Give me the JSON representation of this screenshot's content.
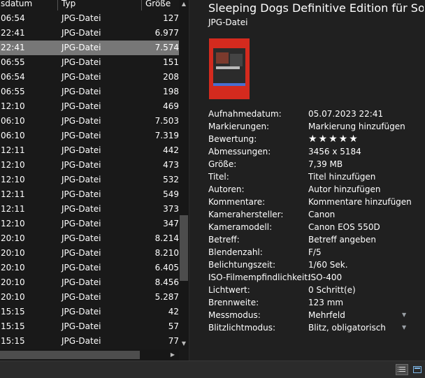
{
  "file_list": {
    "columns": {
      "date": "sdatum",
      "type": "Typ",
      "size": "Größe"
    },
    "rows": [
      {
        "date": "06:54",
        "type": "JPG-Datei",
        "size": "127"
      },
      {
        "date": "22:41",
        "type": "JPG-Datei",
        "size": "6.977"
      },
      {
        "date": "22:41",
        "type": "JPG-Datei",
        "size": "7.574",
        "selected": true
      },
      {
        "date": "06:55",
        "type": "JPG-Datei",
        "size": "151"
      },
      {
        "date": "06:54",
        "type": "JPG-Datei",
        "size": "208"
      },
      {
        "date": "06:55",
        "type": "JPG-Datei",
        "size": "198"
      },
      {
        "date": "12:10",
        "type": "JPG-Datei",
        "size": "469"
      },
      {
        "date": "06:10",
        "type": "JPG-Datei",
        "size": "7.503"
      },
      {
        "date": "06:10",
        "type": "JPG-Datei",
        "size": "7.319"
      },
      {
        "date": "12:11",
        "type": "JPG-Datei",
        "size": "442"
      },
      {
        "date": "12:10",
        "type": "JPG-Datei",
        "size": "473"
      },
      {
        "date": "12:10",
        "type": "JPG-Datei",
        "size": "532"
      },
      {
        "date": "12:11",
        "type": "JPG-Datei",
        "size": "549"
      },
      {
        "date": "12:11",
        "type": "JPG-Datei",
        "size": "373"
      },
      {
        "date": "12:10",
        "type": "JPG-Datei",
        "size": "347"
      },
      {
        "date": "20:10",
        "type": "JPG-Datei",
        "size": "8.214"
      },
      {
        "date": "20:10",
        "type": "JPG-Datei",
        "size": "8.210"
      },
      {
        "date": "20:10",
        "type": "JPG-Datei",
        "size": "6.405"
      },
      {
        "date": "20:10",
        "type": "JPG-Datei",
        "size": "8.456"
      },
      {
        "date": "20:10",
        "type": "JPG-Datei",
        "size": "5.287"
      },
      {
        "date": "15:15",
        "type": "JPG-Datei",
        "size": "42"
      },
      {
        "date": "15:15",
        "type": "JPG-Datei",
        "size": "57"
      },
      {
        "date": "15:15",
        "type": "JPG-Datei",
        "size": "77"
      }
    ]
  },
  "details": {
    "title": "Sleeping Dogs Definitive Edition für Son...",
    "file_kind": "JPG-Datei",
    "properties": [
      {
        "label": "Aufnahmedatum:",
        "value": "05.07.2023 22:41"
      },
      {
        "label": "Markierungen:",
        "value": "Markierung hinzufügen"
      },
      {
        "label": "Bewertung:",
        "value": "★★★★★",
        "rating": 5
      },
      {
        "label": "Abmessungen:",
        "value": "3456 x 5184"
      },
      {
        "label": "Größe:",
        "value": "7,39 MB"
      },
      {
        "label": "Titel:",
        "value": "Titel hinzufügen"
      },
      {
        "label": "Autoren:",
        "value": "Autor hinzufügen"
      },
      {
        "label": "Kommentare:",
        "value": "Kommentare hinzufügen"
      },
      {
        "label": "Kamerahersteller:",
        "value": "Canon"
      },
      {
        "label": "Kameramodell:",
        "value": "Canon EOS 550D"
      },
      {
        "label": "Betreff:",
        "value": "Betreff angeben"
      },
      {
        "label": "Blendenzahl:",
        "value": "F/5"
      },
      {
        "label": "Belichtungszeit:",
        "value": "1/60 Sek."
      },
      {
        "label": "ISO-Filmempfindlichkeit:",
        "value": "ISO-400"
      },
      {
        "label": "Lichtwert:",
        "value": "0 Schritt(e)"
      },
      {
        "label": "Brennweite:",
        "value": "123 mm"
      },
      {
        "label": "Messmodus:",
        "value": "Mehrfeld",
        "dropdown": true
      },
      {
        "label": "Blitzlichtmodus:",
        "value": "Blitz, obligatorisch",
        "dropdown": true
      }
    ]
  },
  "colors": {
    "background": "#191919",
    "details_background": "#202020",
    "selected_row": "#777777",
    "thumbnail_red": "#d42a1e"
  },
  "icons": {
    "scroll_up": "▲",
    "scroll_down": "▼",
    "scroll_right": "▶",
    "dropdown": "▼"
  }
}
